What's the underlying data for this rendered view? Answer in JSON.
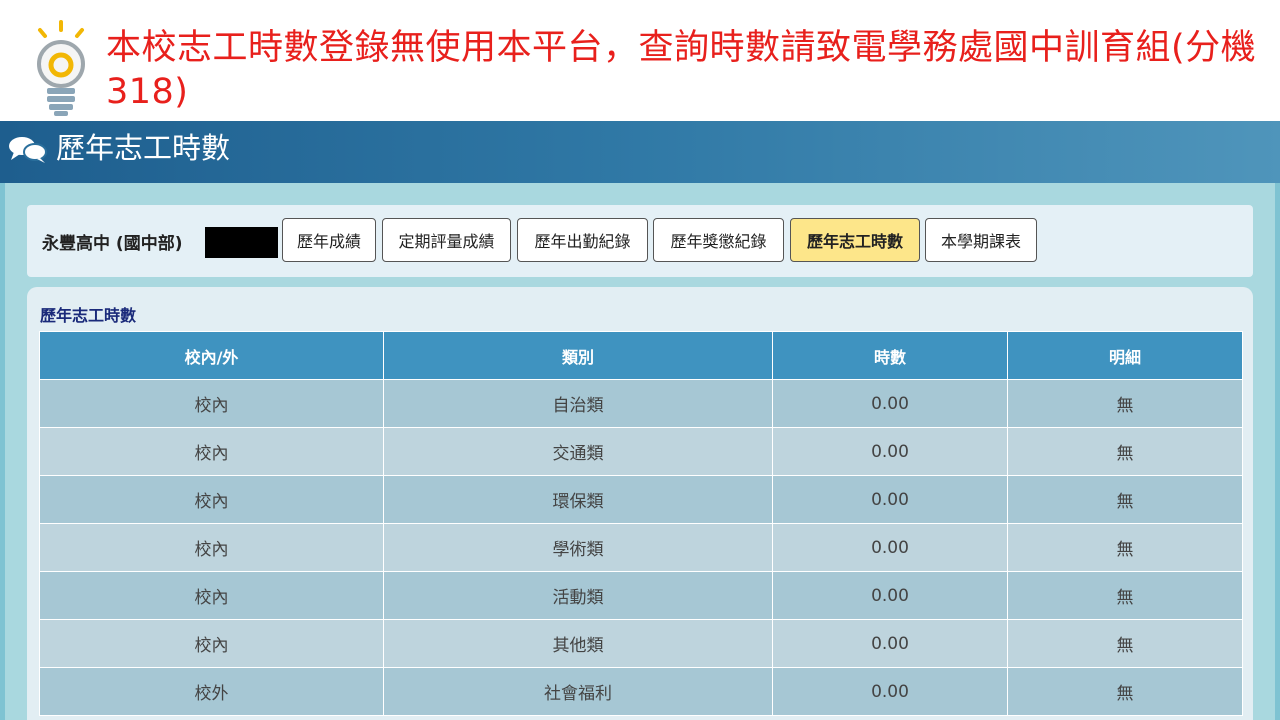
{
  "notice": {
    "text": "本校志工時數登錄無使用本平台，查詢時數請致電學務處國中訓育組(分機318)"
  },
  "header": {
    "title": "歷年志工時數",
    "icon": "comments-icon"
  },
  "student": {
    "school": "永豐高中 (國中部)"
  },
  "tabs": [
    {
      "label": "歷年成績",
      "active": false
    },
    {
      "label": "定期評量成績",
      "active": false
    },
    {
      "label": "歷年出勤紀錄",
      "active": false
    },
    {
      "label": "歷年獎懲紀錄",
      "active": false
    },
    {
      "label": "歷年志工時數",
      "active": true
    },
    {
      "label": "本學期課表",
      "active": false
    }
  ],
  "panel": {
    "title": "歷年志工時數"
  },
  "table": {
    "headers": [
      "校內/外",
      "類別",
      "時數",
      "明細"
    ],
    "rows": [
      [
        "校內",
        "自治類",
        "0.00",
        "無"
      ],
      [
        "校內",
        "交通類",
        "0.00",
        "無"
      ],
      [
        "校內",
        "環保類",
        "0.00",
        "無"
      ],
      [
        "校內",
        "學術類",
        "0.00",
        "無"
      ],
      [
        "校內",
        "活動類",
        "0.00",
        "無"
      ],
      [
        "校內",
        "其他類",
        "0.00",
        "無"
      ],
      [
        "校外",
        "社會福利",
        "0.00",
        "無"
      ]
    ]
  },
  "colors": {
    "notice": "#e8201c",
    "header": "#3079a6",
    "active_tab": "#fde68a"
  }
}
